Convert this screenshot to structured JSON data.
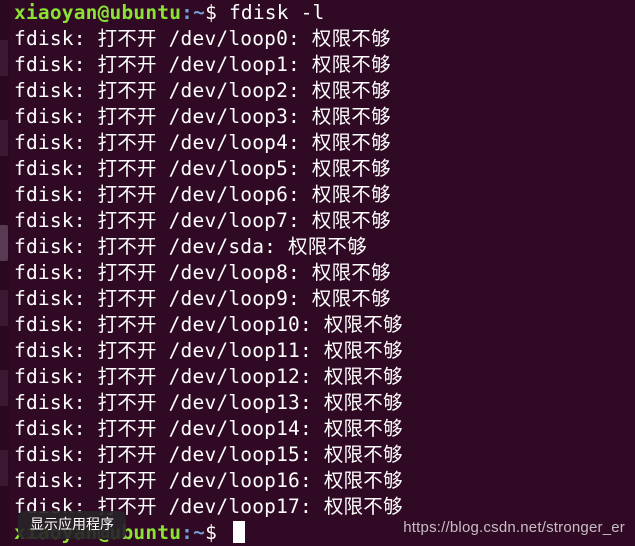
{
  "prompt": {
    "user_host": "xiaoyan@ubuntu",
    "path": ":~",
    "symbol": "$ "
  },
  "first_command": "fdisk -l",
  "output_lines": [
    "fdisk: 打不开 /dev/loop0: 权限不够",
    "fdisk: 打不开 /dev/loop1: 权限不够",
    "fdisk: 打不开 /dev/loop2: 权限不够",
    "fdisk: 打不开 /dev/loop3: 权限不够",
    "fdisk: 打不开 /dev/loop4: 权限不够",
    "fdisk: 打不开 /dev/loop5: 权限不够",
    "fdisk: 打不开 /dev/loop6: 权限不够",
    "fdisk: 打不开 /dev/loop7: 权限不够",
    "fdisk: 打不开 /dev/sda: 权限不够",
    "fdisk: 打不开 /dev/loop8: 权限不够",
    "fdisk: 打不开 /dev/loop9: 权限不够",
    "fdisk: 打不开 /dev/loop10: 权限不够",
    "fdisk: 打不开 /dev/loop11: 权限不够",
    "fdisk: 打不开 /dev/loop12: 权限不够",
    "fdisk: 打不开 /dev/loop13: 权限不够",
    "fdisk: 打不开 /dev/loop14: 权限不够",
    "fdisk: 打不开 /dev/loop15: 权限不够",
    "fdisk: 打不开 /dev/loop16: 权限不够",
    "fdisk: 打不开 /dev/loop17: 权限不够"
  ],
  "tooltip_text": "显示应用程序",
  "watermark": "https://blog.csdn.net/stronger_er",
  "colors": {
    "background": "#300a24",
    "user_host": "#8ae234",
    "path": "#729fcf",
    "text": "#ffffff"
  }
}
